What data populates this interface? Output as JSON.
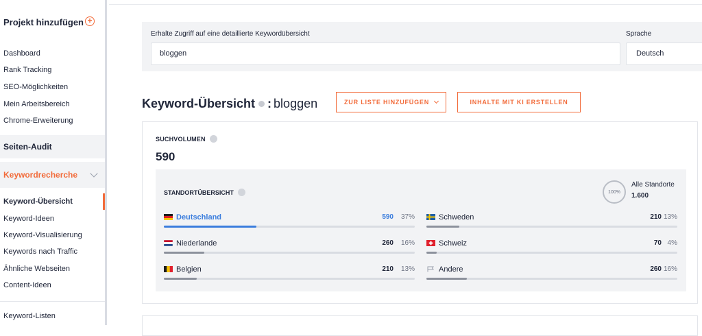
{
  "sidebar": {
    "project_label": "Projekt hinzufügen",
    "items_top": [
      "Dashboard",
      "Rank Tracking",
      "SEO-Möglichkeiten",
      "Mein Arbeitsbereich",
      "Chrome-Erweiterung"
    ],
    "section_audit": "Seiten-Audit",
    "section_keyword": "Keywordrecherche",
    "items_keyword": [
      "Keyword-Übersicht",
      "Keyword-Ideen",
      "Keyword-Visualisierung",
      "Keywords nach Traffic",
      "Ähnliche Webseiten",
      "Content-Ideen"
    ],
    "item_lists": "Keyword-Listen"
  },
  "search": {
    "label": "Erhalte Zugriff auf eine detaillierte Keywordübersicht",
    "value": "bloggen",
    "language_label": "Sprache",
    "language_value": "Deutsch"
  },
  "header": {
    "title": "Keyword-Übersicht",
    "colon": ":",
    "keyword": "bloggen",
    "add_to_list": "ZUR LISTE HINZUFÜGEN",
    "ai_content": "INHALTE MIT KI ERSTELLEN"
  },
  "volume": {
    "label": "SUCHVOLUMEN",
    "value": "590"
  },
  "locations": {
    "label": "STANDORTÜBERSICHT",
    "ring_text": "100%",
    "all_label": "Alle Standorte",
    "all_value": "1.600",
    "rows": [
      {
        "country": "Deutschland",
        "value": "590",
        "pct": "37%",
        "fraction": 0.37,
        "highlight": true
      },
      {
        "country": "Niederlande",
        "value": "260",
        "pct": "16%",
        "fraction": 0.16
      },
      {
        "country": "Belgien",
        "value": "210",
        "pct": "13%",
        "fraction": 0.13
      },
      {
        "country": "Schweden",
        "value": "210",
        "pct": "13%",
        "fraction": 0.13
      },
      {
        "country": "Schweiz",
        "value": "70",
        "pct": "4%",
        "fraction": 0.04
      },
      {
        "country": "Andere",
        "value": "260",
        "pct": "16%",
        "fraction": 0.16
      }
    ]
  },
  "colors": {
    "accent": "#f26b3a",
    "link": "#3b7ddd"
  }
}
